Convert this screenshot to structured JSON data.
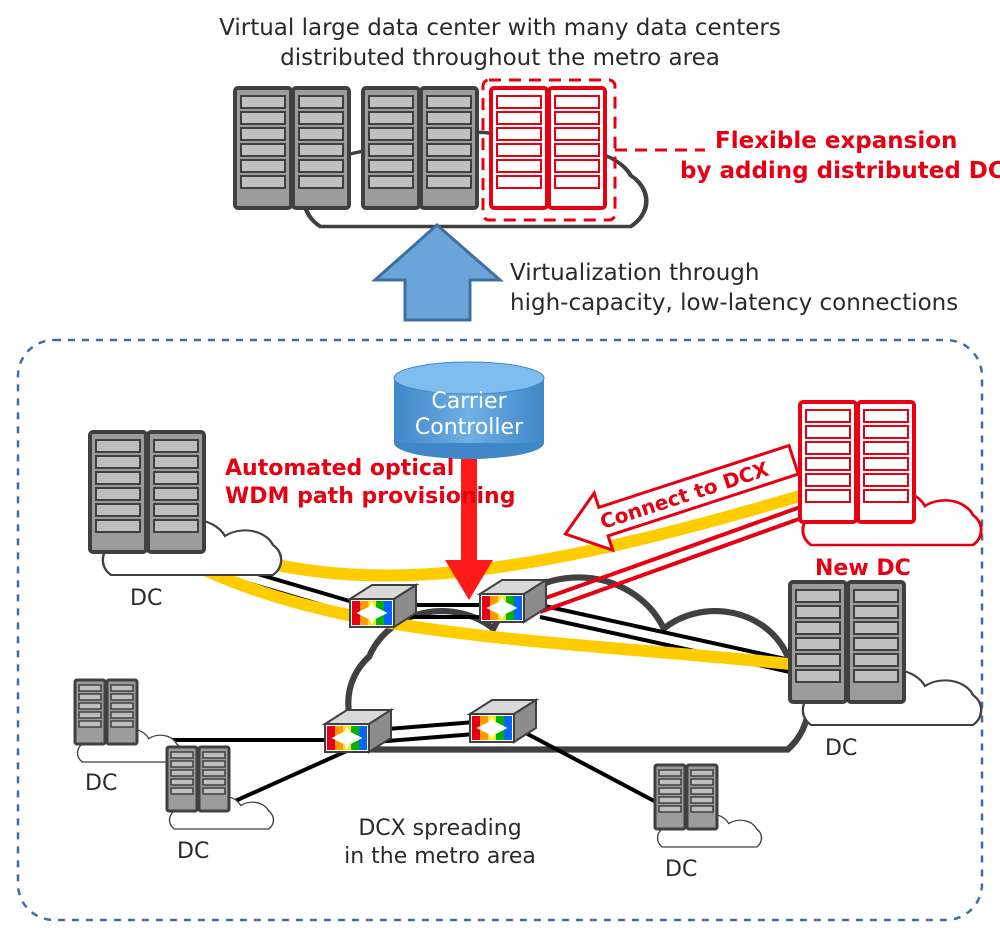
{
  "title_line1": "Virtual large data center with many data centers",
  "title_line2": "distributed throughout the metro area",
  "flexible_line1": "Flexible expansion",
  "flexible_line2": "by adding distributed DCs",
  "virt_line1": "Virtualization through",
  "virt_line2": "high-capacity, low-latency connections",
  "controller_line1": "Carrier",
  "controller_line2": "Controller",
  "auto_line1": "Automated optical",
  "auto_line2": "WDM path provisioning",
  "connect_label": "Connect to DCX",
  "newdc_label": "New DC",
  "dcx_line1": "DCX spreading",
  "dcx_line2": "in the metro area",
  "dc_label": "DC"
}
